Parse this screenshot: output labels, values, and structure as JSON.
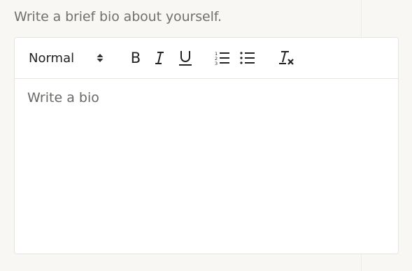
{
  "prompt": {
    "text": "Write a brief bio about yourself."
  },
  "toolbar": {
    "format": "Normal",
    "bold": "B",
    "italic": "I",
    "underline": "U"
  },
  "editor": {
    "placeholder": "Write a bio"
  },
  "icons": {
    "format": "up-down-arrows",
    "bold": "bold",
    "italic": "italic",
    "underline": "underline",
    "ordered_list": "ordered-list",
    "bullet_list": "bullet-list",
    "clear_format": "clear-formatting"
  }
}
